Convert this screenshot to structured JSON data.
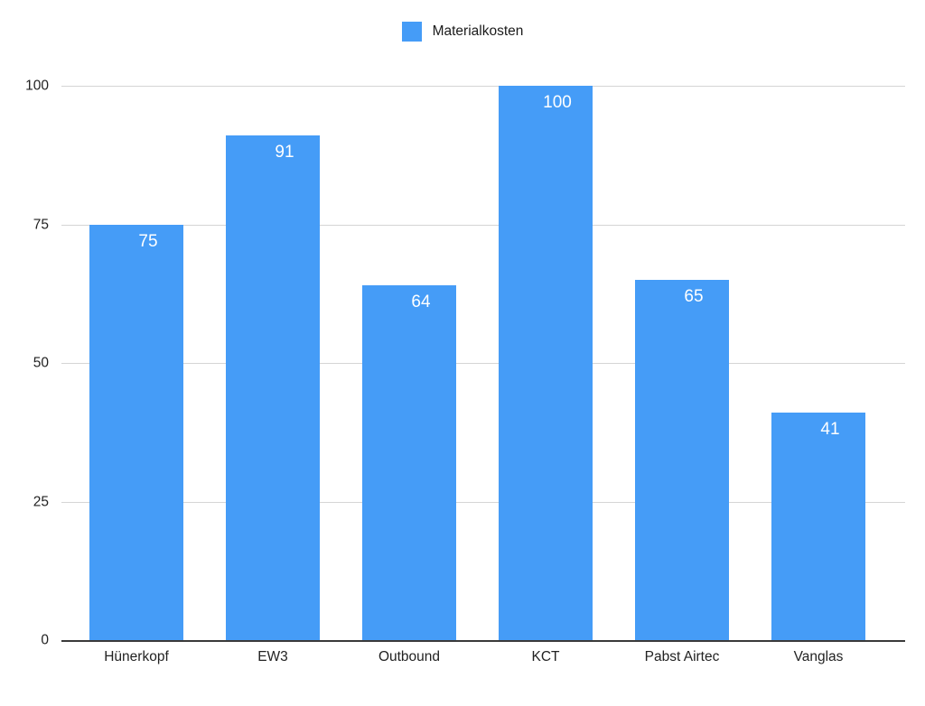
{
  "legend": {
    "position": "top-center",
    "entries": [
      {
        "label": "Materialkosten",
        "color": "#459CF7",
        "swatch_icon": "square-swatch-icon"
      }
    ]
  },
  "axes": {
    "y_ticks": [
      "0",
      "25",
      "50",
      "75",
      "100"
    ],
    "x_ticks": [
      "Hünerkopf",
      "EW3",
      "Outbound",
      "KCT",
      "Pabst Airtec",
      "Vanglas"
    ]
  },
  "bar_labels": [
    "75",
    "91",
    "64",
    "100",
    "65",
    "41"
  ],
  "chart_data": {
    "type": "bar",
    "title": "",
    "subtitle": "",
    "xlabel": "",
    "ylabel": "",
    "categories": [
      "Hünerkopf",
      "EW3",
      "Outbound",
      "KCT",
      "Pabst Airtec",
      "Vanglas"
    ],
    "series": [
      {
        "name": "Materialkosten",
        "color": "#459CF7",
        "values": [
          75,
          91,
          64,
          100,
          65,
          41
        ]
      }
    ],
    "values": [
      75,
      91,
      64,
      100,
      65,
      41
    ],
    "data_labels": [
      75,
      91,
      64,
      100,
      65,
      41
    ],
    "ylim": [
      0,
      100
    ],
    "y_ticks": [
      0,
      25,
      50,
      75,
      100
    ],
    "grid": true,
    "grid_axis": "y",
    "legend": true,
    "legend_position": "top-center",
    "background": "#ffffff"
  }
}
